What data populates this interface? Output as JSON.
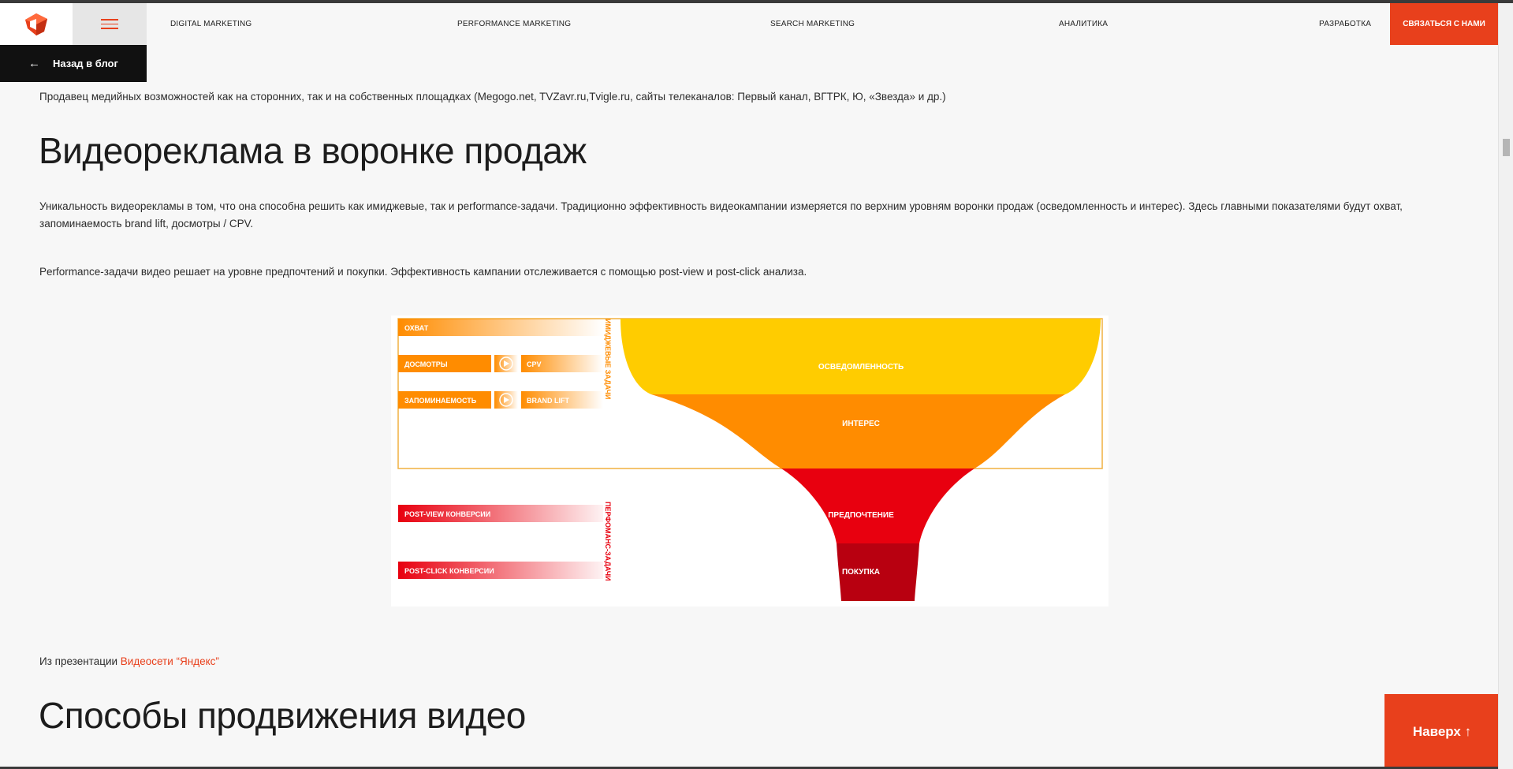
{
  "header": {
    "nav": [
      {
        "label": "DIGITAL MARKETING"
      },
      {
        "label": "PERFORMANCE MARKETING"
      },
      {
        "label": "SEARCH MARKETING"
      },
      {
        "label": "АНАЛИТИКА"
      },
      {
        "label": "РАЗРАБОТКА"
      }
    ],
    "cta_label": "СВЯЗАТЬСЯ С НАМИ",
    "brand_color": "#e8401c"
  },
  "back_button": {
    "label": "Назад в блог",
    "icon": "arrow-left-icon"
  },
  "article": {
    "intro_paragraph": "Продавец медийных возможностей как на сторонних, так и на собственных площадках (Megogo.net, TVZavr.ru,Tvigle.ru, сайты телеканалов: Первый канал, ВГТРК, Ю, «Звезда» и др.)",
    "heading_1": "Видеореклама в воронке продаж",
    "paragraph_1": "Уникальность видеорекламы в том, что она способна решить как имиджевые, так и performance-задачи. Традиционно эффективность видеокампании измеряется по верхним уровням воронки продаж (осведомленность и интерес). Здесь главными показателями будут охват, запоминаемость brand lift, досмотры / CPV.",
    "paragraph_2": "Performance-задачи видео решает на уровне предпочтений и покупки. Эффективность кампании отслеживается с помощью post-view и post-click анализа.",
    "source_prefix": "Из презентации ",
    "source_link": "Видеосети “Яндекс”",
    "heading_2": "Способы продвижения видео"
  },
  "funnel": {
    "left_labels": {
      "reach": "ОХВАТ",
      "views": "ДОСМОТРЫ",
      "cpv": "CPV",
      "recall": "ЗАПОМИНАЕМОСТЬ",
      "brand_lift": "BRAND LIFT",
      "post_view": "POST-VIEW КОНВЕРСИИ",
      "post_click": "POST-CLICK КОНВЕРСИИ"
    },
    "group_labels": {
      "image": "ИМИДЖЕВЫЕ ЗАДАЧИ",
      "performance": "ПЕРФОМАНС-ЗАДАЧИ"
    },
    "stages": {
      "awareness": "ОСВЕДОМЛЕННОСТЬ",
      "interest": "ИНТЕРЕС",
      "preference": "ПРЕДПОЧТЕНИЕ",
      "purchase": "ПОКУПКА"
    },
    "colors": {
      "awareness": "#ffcc00",
      "interest": "#ff8c00",
      "preference": "#e8000f",
      "purchase": "#b80010"
    }
  },
  "scroll_top": {
    "label": "Наверх ↑"
  }
}
